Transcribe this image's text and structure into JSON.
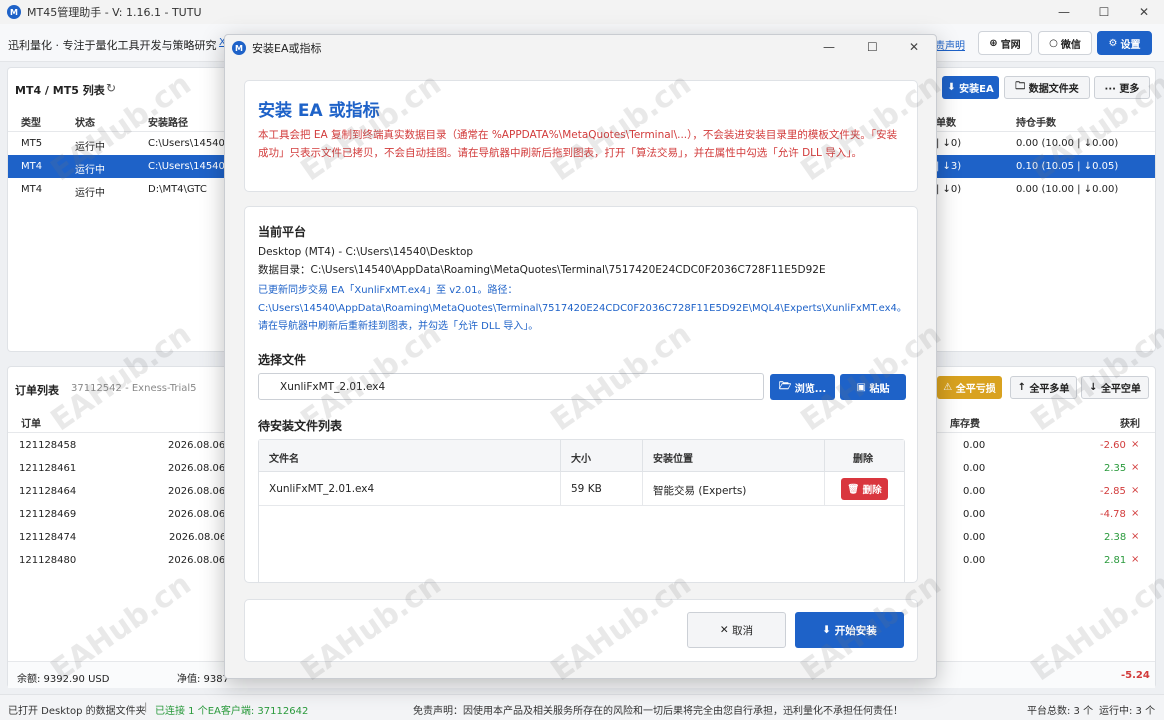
{
  "app": {
    "logo": "M",
    "title": "MT45管理助手 - V: 1.16.1 - TUTU",
    "win_min": "—",
    "win_max": "☐",
    "win_close": "✕"
  },
  "header": {
    "brand": "迅利量化 · 专注于量化工具开发与策略研究",
    "link_x": "X",
    "disclaimer_link": "责声明",
    "official": "官网",
    "wechat": "微信",
    "settings": "设置"
  },
  "terminals": {
    "title": "MT4 / MT5 列表",
    "refresh": "↻",
    "buttons": {
      "install": "安装EA",
      "data_folder": "数据文件夹",
      "more": "··· 更多"
    },
    "columns": [
      "类型",
      "状态",
      "安装路径",
      "单数",
      "持仓手数"
    ],
    "rows": [
      {
        "type": "MT5",
        "status": "运行中",
        "path": "C:\\Users\\14540\\Des",
        "count": "| ↓0)",
        "lots": "0.00 (10.00 | ↓0.00)"
      },
      {
        "type": "MT4",
        "status": "运行中",
        "path": "C:\\Users\\14540\\De",
        "count": "| ↓3)",
        "lots": "0.10 (10.05 | ↓0.05)"
      },
      {
        "type": "MT4",
        "status": "运行中",
        "path": "D:\\MT4\\GTC",
        "count": "| ↓0)",
        "lots": "0.00 (10.00 | ↓0.00)"
      }
    ]
  },
  "orders": {
    "title": "订单列表",
    "account": "37112542 - Exness-Trial5",
    "buttons": {
      "close_loss": "全平亏损",
      "close_buy": "全平多单",
      "close_sell": "全平空单"
    },
    "columns": [
      "订单",
      "库存费",
      "获利"
    ],
    "rows": [
      {
        "id": "121128458",
        "time": "2026.08.06 09",
        "swap": "0.00",
        "profit": "-2.60"
      },
      {
        "id": "121128461",
        "time": "2026.08.06 09",
        "swap": "0.00",
        "profit": "2.35"
      },
      {
        "id": "121128464",
        "time": "2026.08.06 09",
        "swap": "0.00",
        "profit": "-2.85"
      },
      {
        "id": "121128469",
        "time": "2026.08.06 09",
        "swap": "0.00",
        "profit": "-4.78"
      },
      {
        "id": "121128474",
        "time": "2026.08.06 0",
        "swap": "0.00",
        "profit": "2.38"
      },
      {
        "id": "121128480",
        "time": "2026.08.06 09",
        "swap": "0.00",
        "profit": "2.81"
      }
    ],
    "delete_mark": "×",
    "footer": {
      "balance": "余额: 9392.90 USD",
      "equity": "净值: 9387",
      "total": "-5.24"
    }
  },
  "status": {
    "left": "已打开 Desktop 的数据文件夹",
    "sep": "|",
    "connected": "已连接 1 个EA客户端: 37112642",
    "disclaimer": "免责声明：因使用本产品及相关服务所存在的风险和一切后果将完全由您自行承担，迅利量化不承担任何责任！",
    "platform_total": "平台总数: 3 个",
    "running": "运行中: 3 个"
  },
  "modal": {
    "title": "安装EA或指标",
    "win_min": "—",
    "win_max": "☐",
    "win_close": "✕",
    "heading": "安装 EA 或指标",
    "notice": "本工具会把 EA 复制到终端真实数据目录（通常在 %APPDATA%\\MetaQuotes\\Terminal\\...），不会装进安装目录里的模板文件夹。「安装成功」只表示文件已拷贝，不会自动挂图。请在导航器中刷新后拖到图表，打开「算法交易」，并在属性中勾选「允许 DLL 导入」。",
    "platform_label": "当前平台",
    "platform_line": "Desktop (MT4) - C:\\Users\\14540\\Desktop",
    "data_dir": "数据目录：C:\\Users\\14540\\AppData\\Roaming\\MetaQuotes\\Terminal\\7517420E24CDC0F2036C728F11E5D92E",
    "sync_msg": "已更新同步交易 EA「XunliFxMT.ex4」至 v2.01。路径：C:\\Users\\14540\\AppData\\Roaming\\MetaQuotes\\Terminal\\7517420E24CDC0F2036C728F11E5D92E\\MQL4\\Experts\\XunliFxMT.ex4。请在导航器中刷新后重新挂到图表，并勾选「允许 DLL 导入」。",
    "select_label": "选择文件",
    "file_value": "XunliFxMT_2.01.ex4",
    "browse": "浏览...",
    "paste": "粘贴",
    "list_label": "待安装文件列表",
    "columns": [
      "文件名",
      "大小",
      "安装位置",
      "删除"
    ],
    "files": [
      {
        "name": "XunliFxMT_2.01.ex4",
        "size": "59 KB",
        "location": "智能交易 (Experts)",
        "delete": "删除"
      }
    ],
    "cancel": "取消",
    "start": "开始安装"
  },
  "watermark": "EAHub.cn",
  "colors": {
    "accent": "#1e62c8",
    "notice_red": "#d23b3b",
    "heading_blue": "#1e62c8",
    "delete_red": "#d9363e"
  }
}
